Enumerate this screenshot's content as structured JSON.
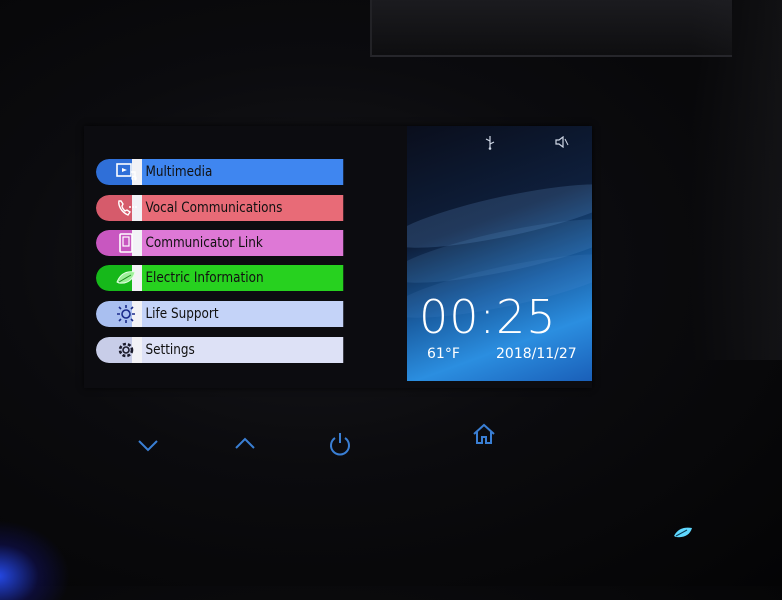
{
  "menu": {
    "items": [
      {
        "label": "Multimedia",
        "icon": "multimedia-icon"
      },
      {
        "label": "Vocal Communications",
        "icon": "phone-icon"
      },
      {
        "label": "Communicator Link",
        "icon": "device-link-icon"
      },
      {
        "label": "Electric Information",
        "icon": "leaf-icon"
      },
      {
        "label": "Life Support",
        "icon": "climate-icon"
      },
      {
        "label": "Settings",
        "icon": "gear-icon"
      }
    ]
  },
  "status": {
    "usb_icon": "usb-icon",
    "volume_icon": "volume-icon"
  },
  "clock": {
    "time": "00:25",
    "temperature": "61°F",
    "date": "2018/11/27"
  },
  "hardware_buttons": {
    "down": "chevron-down-icon",
    "up": "chevron-up-icon",
    "power": "power-icon",
    "home": "home-icon"
  },
  "colors": {
    "multimedia": "#3f86f0",
    "vocal": "#e86b77",
    "communicator": "#de78d6",
    "electric": "#27d11f",
    "life_support": "#c4d3f8",
    "settings": "#dde1f6",
    "hw_button": "#3a7fd4"
  }
}
